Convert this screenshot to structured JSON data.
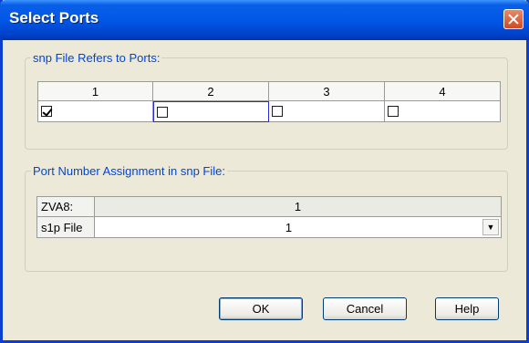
{
  "window": {
    "title": "Select Ports"
  },
  "ports_group": {
    "legend": "snp File Refers to Ports:",
    "headers": [
      "1",
      "2",
      "3",
      "4"
    ],
    "checked": [
      true,
      false,
      false,
      false
    ]
  },
  "assignment_group": {
    "legend": "Port Number Assignment in snp File:",
    "row1_label": "ZVA8:",
    "row1_value": "1",
    "row2_label": "s1p File",
    "row2_value": "1"
  },
  "buttons": {
    "ok": "OK",
    "cancel": "Cancel",
    "help": "Help"
  }
}
